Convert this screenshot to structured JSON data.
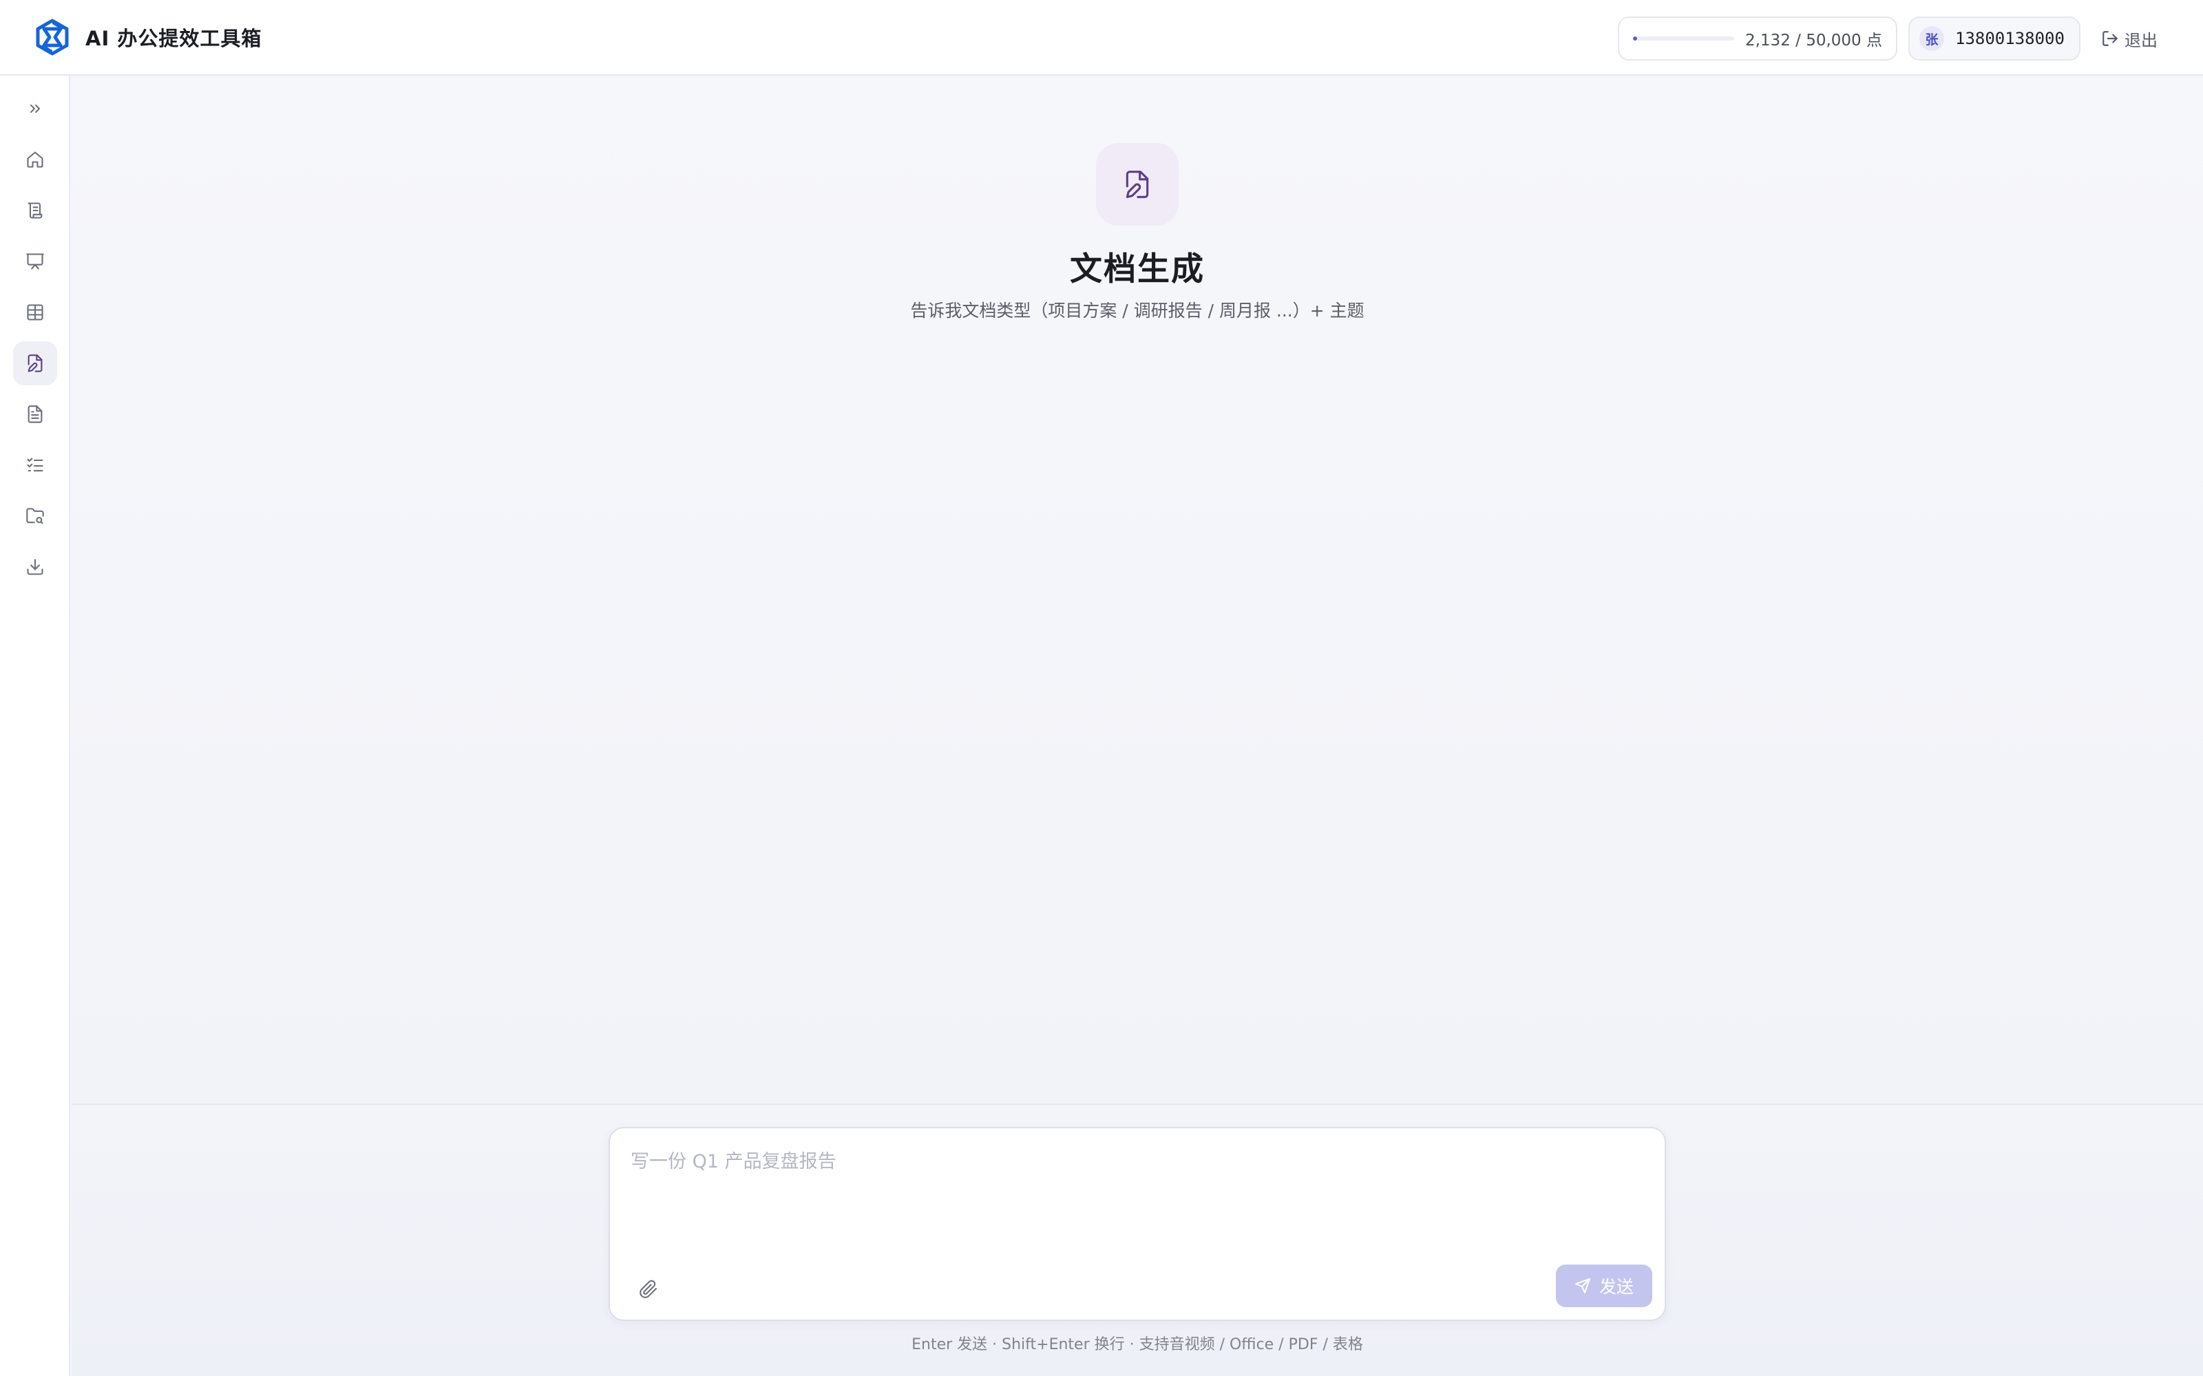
{
  "app": {
    "title": "AI 办公提效工具箱"
  },
  "header": {
    "quota": {
      "text": "2,132 / 50,000 点",
      "used_fraction": 0.04264
    },
    "user": {
      "avatar_initial": "张",
      "phone": "13800138000"
    },
    "logout_label": "退出"
  },
  "sidebar": {
    "items": [
      {
        "icon": "expand-icon"
      },
      {
        "icon": "home-icon"
      },
      {
        "icon": "scroll-icon"
      },
      {
        "icon": "presentation-icon"
      },
      {
        "icon": "table-icon"
      },
      {
        "icon": "file-edit-icon",
        "active": true
      },
      {
        "icon": "file-text-icon"
      },
      {
        "icon": "checklist-icon"
      },
      {
        "icon": "folder-search-icon"
      },
      {
        "icon": "download-icon"
      }
    ]
  },
  "main": {
    "hero_icon": "file-edit-icon",
    "title": "文档生成",
    "subtitle": "告诉我文档类型（项目方案 / 调研报告 / 周月报 ...）+ 主题"
  },
  "composer": {
    "placeholder": "写一份 Q1 产品复盘报告",
    "value": "",
    "send_label": "发送",
    "hint": "Enter 发送 · Shift+Enter 换行 · 支持音视频 / Office / PDF / 表格"
  },
  "colors": {
    "accent": "#5b5bd6",
    "send_disabled": "#c4c5ef",
    "brand_blue": "#1565d8",
    "hero_bg": "#f1ebf8",
    "hero_icon": "#5d3f86"
  }
}
